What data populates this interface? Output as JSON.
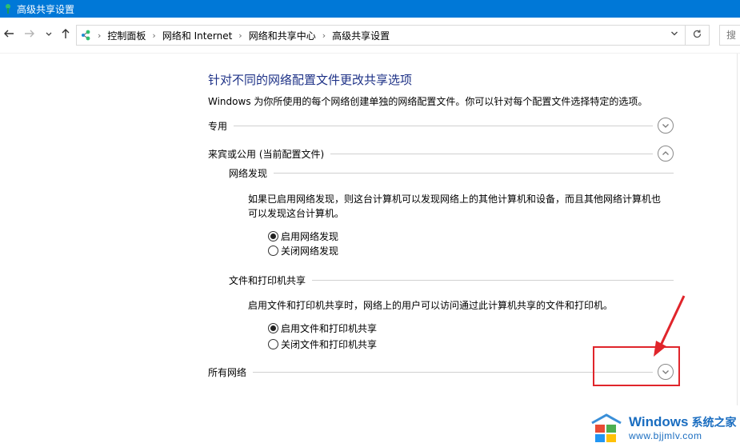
{
  "window": {
    "title": "高级共享设置"
  },
  "nav": {
    "breadcrumbs": [
      "控制面板",
      "网络和 Internet",
      "网络和共享中心",
      "高级共享设置"
    ],
    "search_placeholder": "搜"
  },
  "page": {
    "title": "针对不同的网络配置文件更改共享选项",
    "description": "Windows 为你所使用的每个网络创建单独的网络配置文件。你可以针对每个配置文件选择特定的选项。"
  },
  "sections": {
    "private": {
      "label": "专用"
    },
    "guest_public": {
      "label": "来宾或公用 (当前配置文件)"
    },
    "all_networks": {
      "label": "所有网络"
    }
  },
  "network_discovery": {
    "label": "网络发现",
    "description_line1": "如果已启用网络发现，则这台计算机可以发现网络上的其他计算机和设备，而且其他网络计算机也",
    "description_line2": "可以发现这台计算机。",
    "options": [
      {
        "label": "启用网络发现",
        "selected": true
      },
      {
        "label": "关闭网络发现",
        "selected": false
      }
    ]
  },
  "file_printer_sharing": {
    "label": "文件和打印机共享",
    "description": "启用文件和打印机共享时，网络上的用户可以访问通过此计算机共享的文件和打印机。",
    "options": [
      {
        "label": "启用文件和打印机共享",
        "selected": true
      },
      {
        "label": "关闭文件和打印机共享",
        "selected": false
      }
    ]
  },
  "watermark": {
    "brand": "Windows",
    "cn": "系统之家",
    "url": "www.bjjmlv.com"
  },
  "colors": {
    "titlebar": "#0078d7",
    "page_title": "#1e3287",
    "annotation": "#e0252b"
  }
}
